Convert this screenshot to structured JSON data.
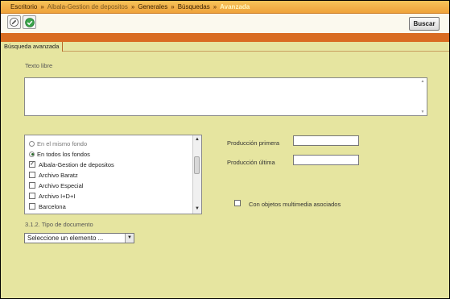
{
  "breadcrumb": {
    "items": [
      "Escritorio",
      "Albala-Gestion de depositos",
      "Generales",
      "Búsquedas"
    ],
    "current": "Avanzada",
    "separator": "»"
  },
  "toolbar": {
    "edit_icon": "pencil-icon",
    "ok_icon": "check-icon",
    "search_label": "Buscar"
  },
  "tab": {
    "label": "Búsqueda avanzada"
  },
  "free_text": {
    "label": "Texto libre",
    "value": ""
  },
  "scope_list": {
    "radios": [
      {
        "label": "En el mismo fondo",
        "selected": false
      },
      {
        "label": "En todos los fondos",
        "selected": true
      }
    ],
    "checkboxes": [
      {
        "label": "Albala-Gestion de depositos",
        "checked": true,
        "mark": "✓"
      },
      {
        "label": "Archivo Baratz",
        "checked": false,
        "mark": ""
      },
      {
        "label": "Archivo Especial",
        "checked": false,
        "mark": ""
      },
      {
        "label": "Archivo I+D+I",
        "checked": false,
        "mark": ""
      },
      {
        "label": "Barcelona",
        "checked": false,
        "mark": ""
      }
    ]
  },
  "fields": {
    "produccion_primera": "Producción primera",
    "produccion_ultima": "Producción última"
  },
  "multimedia": {
    "label": "Con objetos multimedia asociados",
    "checked": false
  },
  "doc_type": {
    "label": "3.1.2. Tipo de documento",
    "selected": "Seleccione un elemento ..."
  },
  "colors": {
    "background": "#e6e5a0",
    "orange": "#d96c22",
    "breadcrumb": "#efa23a"
  }
}
